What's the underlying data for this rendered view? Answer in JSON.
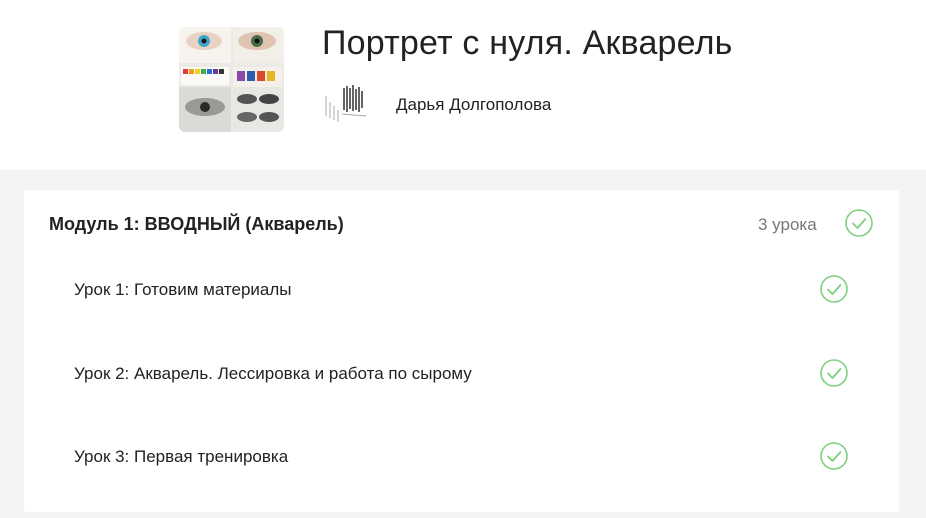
{
  "course": {
    "title": "Портрет с нуля. Акварель",
    "author": "Дарья Долгополова",
    "cover_icon": "course-cover-image",
    "avatar_icon": "author-avatar-image"
  },
  "module": {
    "title": "Модуль 1: ВВОДНЫЙ (Акварель)",
    "count_label": "3 урока",
    "status_icon": "check-circle-icon",
    "lessons": [
      {
        "label": "Урок 1: Готовим материалы",
        "status_icon": "check-circle-icon"
      },
      {
        "label": "Урок 2: Акварель. Лессировка и работа по сырому",
        "status_icon": "check-circle-icon"
      },
      {
        "label": "Урок 3: Первая тренировка",
        "status_icon": "check-circle-icon"
      }
    ]
  },
  "colors": {
    "check_green": "#7ed07e",
    "page_bg": "#f3f4f6",
    "card_bg": "#ffffff"
  }
}
